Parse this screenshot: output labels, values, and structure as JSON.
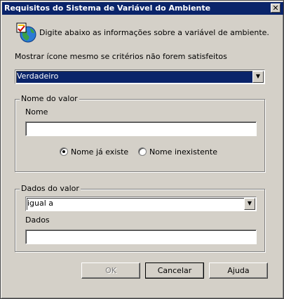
{
  "window": {
    "title": "Requisitos do Sistema de Variável do Ambiente",
    "close_glyph": "✕"
  },
  "header": {
    "icon": "globe-checklist-icon",
    "text": "Digite abaixo as informações sobre a variável de ambiente."
  },
  "show_icon": {
    "label": "Mostrar ícone mesmo se critérios não forem satisfeitos",
    "selected": "Verdadeiro"
  },
  "value_name_group": {
    "legend": "Nome do valor",
    "name_label": "Nome",
    "name_value": "",
    "radio_exists": "Nome já existe",
    "radio_not_exists": "Nome inexistente",
    "selected_radio": "exists"
  },
  "value_data_group": {
    "legend": "Dados do valor",
    "operator_selected": "igual a",
    "data_label": "Dados",
    "data_value": ""
  },
  "buttons": {
    "ok": "OK",
    "cancel": "Cancelar",
    "help": "Ajuda"
  },
  "colors": {
    "titlebar": "#0a246a",
    "face": "#d4d0c8",
    "selection": "#0a246a"
  }
}
